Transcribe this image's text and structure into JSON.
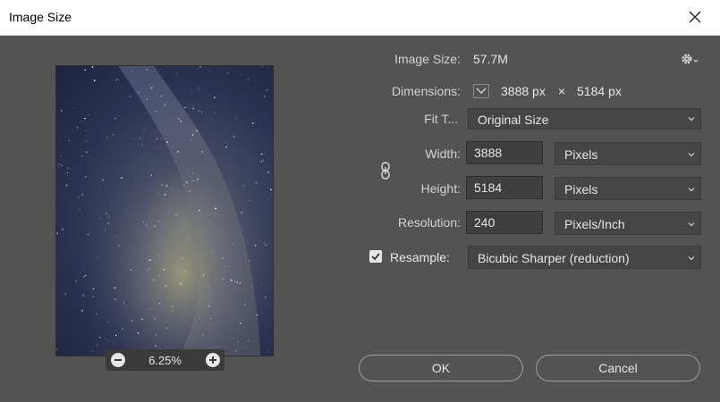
{
  "window": {
    "title": "Image Size"
  },
  "preview": {
    "zoom": "6.25%"
  },
  "info": {
    "image_size_label": "Image Size:",
    "image_size_value": "57.7M",
    "dimensions_label": "Dimensions:",
    "dimensions_width": "3888 px",
    "dimensions_sep": "×",
    "dimensions_height": "5184 px"
  },
  "fit_to": {
    "label": "Fit T...",
    "value": "Original Size"
  },
  "width": {
    "label": "Width:",
    "value": "3888",
    "unit": "Pixels"
  },
  "height": {
    "label": "Height:",
    "value": "5184",
    "unit": "Pixels"
  },
  "resolution": {
    "label": "Resolution:",
    "value": "240",
    "unit": "Pixels/Inch"
  },
  "resample": {
    "label": "Resample:",
    "checked": true,
    "value": "Bicubic Sharper (reduction)"
  },
  "buttons": {
    "ok": "OK",
    "cancel": "Cancel"
  },
  "icons": {
    "close": "close-icon",
    "gear": "gear-icon",
    "link": "link-icon",
    "zoom_out": "zoom-out-icon",
    "zoom_in": "zoom-in-icon"
  }
}
